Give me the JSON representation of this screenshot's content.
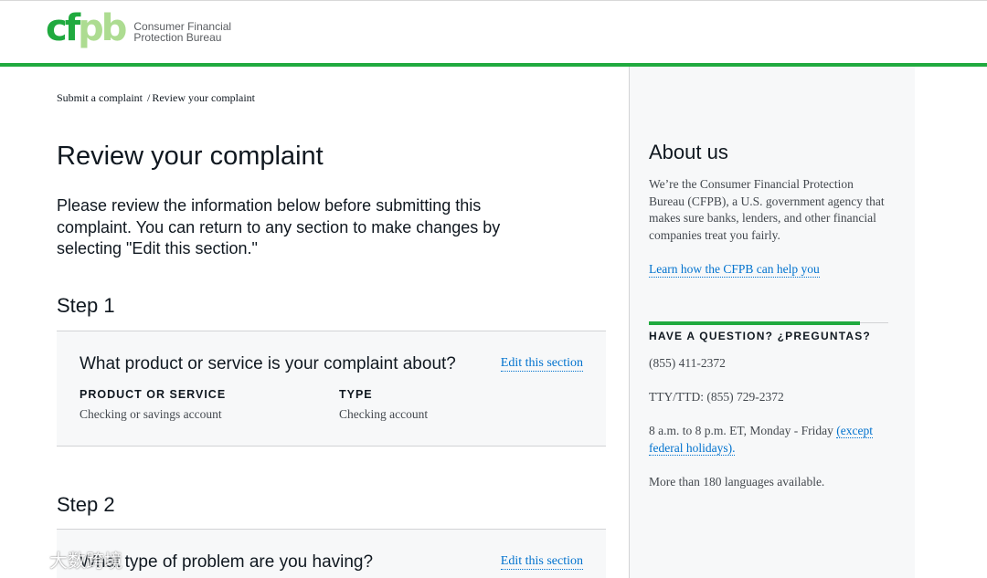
{
  "header": {
    "logo_mark_cf": "cf",
    "logo_mark_pb": "pb",
    "logo_line1": "Consumer Financial",
    "logo_line2": "Protection Bureau",
    "accent_color": "#20aa3f"
  },
  "breadcrumb": {
    "item1": "Submit a complaint",
    "separator": "/",
    "item2": "Review your complaint"
  },
  "main": {
    "title": "Review your complaint",
    "intro": "Please review the information below before submitting this complaint. You can return to any section to make changes by selecting \"Edit this section.\"",
    "step1": {
      "heading": "Step 1",
      "question": "What product or service is your complaint about?",
      "edit_label": "Edit this section",
      "fields": [
        {
          "label": "PRODUCT OR SERVICE",
          "value": "Checking or savings account"
        },
        {
          "label": "TYPE",
          "value": "Checking account"
        }
      ]
    },
    "step2": {
      "heading": "Step 2",
      "question": "What type of problem are you having?",
      "edit_label": "Edit this section"
    }
  },
  "sidebar": {
    "about_title": "About us",
    "about_body": "We’re the Consumer Financial Protection Bureau (CFPB), a U.S. government agency that makes sure banks, lenders, and other financial companies treat you fairly.",
    "learn_link": "Learn how the CFPB can help you",
    "question_heading": "HAVE A QUESTION? ¿PREGUNTAS?",
    "phone": "(855) 411-2372",
    "tty": "TTY/TTD: (855) 729-2372",
    "hours_text": "8 a.m. to 8 p.m. ET, Monday - Friday ",
    "hours_link": "(except federal holidays).",
    "languages": "More than 180 languages available."
  },
  "watermark": {
    "text": "大数跨境"
  }
}
